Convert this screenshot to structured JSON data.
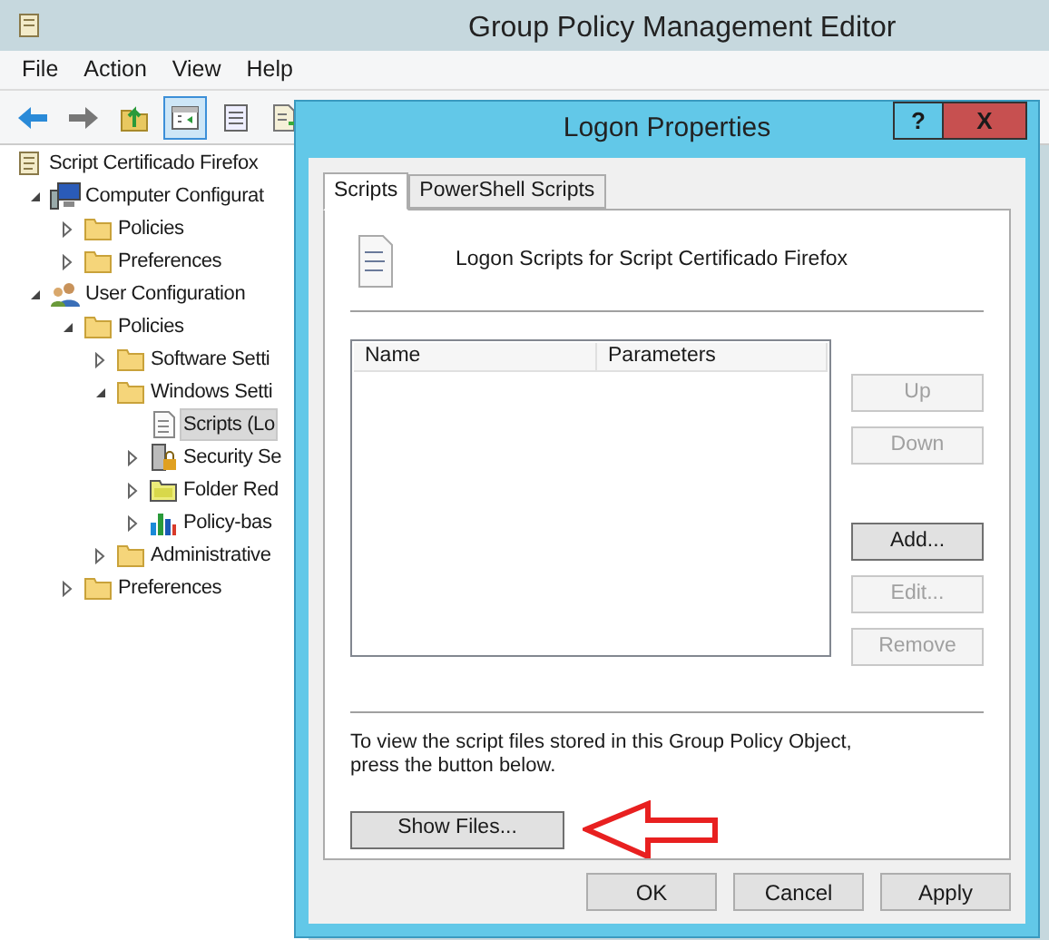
{
  "window": {
    "title": "Group Policy Management Editor"
  },
  "menu": [
    "File",
    "Action",
    "View",
    "Help"
  ],
  "toolbar": [
    {
      "kind": "back",
      "selected": false
    },
    {
      "kind": "forward",
      "selected": false
    },
    {
      "kind": "up",
      "selected": false
    },
    {
      "kind": "tree",
      "selected": true
    },
    {
      "kind": "properties",
      "selected": false
    },
    {
      "kind": "export",
      "selected": false
    }
  ],
  "tree": [
    {
      "label": "Script Certificado Firefox",
      "kind": "scroll",
      "selected": false,
      "children": [
        {
          "label": "Computer Configurat",
          "kind": "computer",
          "expanded": true,
          "selected": false,
          "children": [
            {
              "label": "Policies",
              "kind": "folder",
              "expanded": false,
              "selected": false
            },
            {
              "label": "Preferences",
              "kind": "folder",
              "expanded": false,
              "selected": false
            }
          ]
        },
        {
          "label": "User Configuration",
          "kind": "users",
          "expanded": true,
          "selected": false,
          "children": [
            {
              "label": "Policies",
              "kind": "folder",
              "expanded": true,
              "selected": false,
              "children": [
                {
                  "label": "Software Setti",
                  "kind": "folder",
                  "expanded": false,
                  "selected": false
                },
                {
                  "label": "Windows Setti",
                  "kind": "folder",
                  "expanded": true,
                  "selected": false,
                  "children": [
                    {
                      "label": "Scripts (Lo",
                      "kind": "script",
                      "selected": true
                    },
                    {
                      "label": "Security Se",
                      "kind": "security",
                      "expanded": false,
                      "selected": false
                    },
                    {
                      "label": "Folder Red",
                      "kind": "redirect",
                      "expanded": false,
                      "selected": false
                    },
                    {
                      "label": "Policy-bas",
                      "kind": "chart",
                      "expanded": false,
                      "selected": false
                    }
                  ]
                },
                {
                  "label": "Administrative",
                  "kind": "folder",
                  "expanded": false,
                  "selected": false
                }
              ]
            },
            {
              "label": "Preferences",
              "kind": "folder",
              "expanded": false,
              "selected": false
            }
          ]
        }
      ]
    }
  ],
  "dialog": {
    "title": "Logon Properties",
    "help": "?",
    "close": "X",
    "tabs": [
      {
        "label": "Scripts",
        "selected": true
      },
      {
        "label": "PowerShell Scripts",
        "selected": false
      }
    ],
    "heading": "Logon Scripts for Script Certificado Firefox",
    "columns": [
      "Name",
      "Parameters"
    ],
    "side_buttons": [
      {
        "label": "Up",
        "disabled": true
      },
      {
        "label": "Down",
        "disabled": true
      },
      {
        "label": "Add...",
        "disabled": false
      },
      {
        "label": "Edit...",
        "disabled": true
      },
      {
        "label": "Remove",
        "disabled": true
      }
    ],
    "note": "To view the script files stored in this Group Policy Object, press the button below.",
    "show_files": "Show Files...",
    "buttons": [
      "OK",
      "Cancel",
      "Apply"
    ]
  }
}
